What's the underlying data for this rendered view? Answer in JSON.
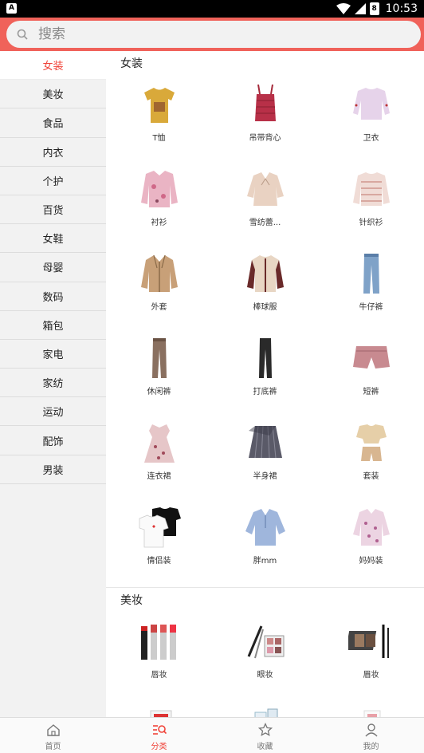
{
  "status_bar": {
    "time": "10:53",
    "battery": "8"
  },
  "search": {
    "placeholder": "搜索",
    "value": ""
  },
  "sidebar": {
    "items": [
      {
        "label": "女装",
        "active": true
      },
      {
        "label": "美妆"
      },
      {
        "label": "食品"
      },
      {
        "label": "内衣"
      },
      {
        "label": "个护"
      },
      {
        "label": "百货"
      },
      {
        "label": "女鞋"
      },
      {
        "label": "母婴"
      },
      {
        "label": "数码"
      },
      {
        "label": "箱包"
      },
      {
        "label": "家电"
      },
      {
        "label": "家纺"
      },
      {
        "label": "运动"
      },
      {
        "label": "配饰"
      },
      {
        "label": "男装"
      }
    ]
  },
  "sections": [
    {
      "title": "女装",
      "items": [
        {
          "label": "T恤",
          "icon": "tshirt-icon"
        },
        {
          "label": "吊带背心",
          "icon": "camisole-icon"
        },
        {
          "label": "卫衣",
          "icon": "sweatshirt-icon"
        },
        {
          "label": "衬衫",
          "icon": "blouse-icon"
        },
        {
          "label": "雪纺蕾...",
          "icon": "chiffon-icon"
        },
        {
          "label": "针织衫",
          "icon": "knit-icon"
        },
        {
          "label": "外套",
          "icon": "coat-icon"
        },
        {
          "label": "棒球服",
          "icon": "baseball-jacket-icon"
        },
        {
          "label": "牛仔裤",
          "icon": "jeans-icon"
        },
        {
          "label": "休闲裤",
          "icon": "casual-pants-icon"
        },
        {
          "label": "打底裤",
          "icon": "leggings-icon"
        },
        {
          "label": "短裤",
          "icon": "shorts-icon"
        },
        {
          "label": "连衣裙",
          "icon": "dress-icon"
        },
        {
          "label": "半身裙",
          "icon": "skirt-icon"
        },
        {
          "label": "套装",
          "icon": "outfit-set-icon"
        },
        {
          "label": "情侣装",
          "icon": "couple-tees-icon"
        },
        {
          "label": "胖mm",
          "icon": "plus-size-icon"
        },
        {
          "label": "妈妈装",
          "icon": "mom-wear-icon"
        }
      ]
    },
    {
      "title": "美妆",
      "items": [
        {
          "label": "唇妆",
          "icon": "lipstick-icon"
        },
        {
          "label": "眼妆",
          "icon": "eye-makeup-icon"
        },
        {
          "label": "眉妆",
          "icon": "eyebrow-icon"
        },
        {
          "label": "",
          "icon": "skincare-box-icon"
        },
        {
          "label": "",
          "icon": "skincare-tube-icon"
        },
        {
          "label": "",
          "icon": "skincare-bottle-icon"
        }
      ]
    }
  ],
  "bottom_nav": [
    {
      "label": "首页",
      "icon": "home-icon"
    },
    {
      "label": "分类",
      "icon": "category-icon",
      "active": true
    },
    {
      "label": "收藏",
      "icon": "star-icon"
    },
    {
      "label": "我的",
      "icon": "user-icon"
    }
  ],
  "colors": {
    "accent": "#f0443a",
    "header": "#f0625a",
    "sidebar_bg": "#f2f2f2"
  }
}
